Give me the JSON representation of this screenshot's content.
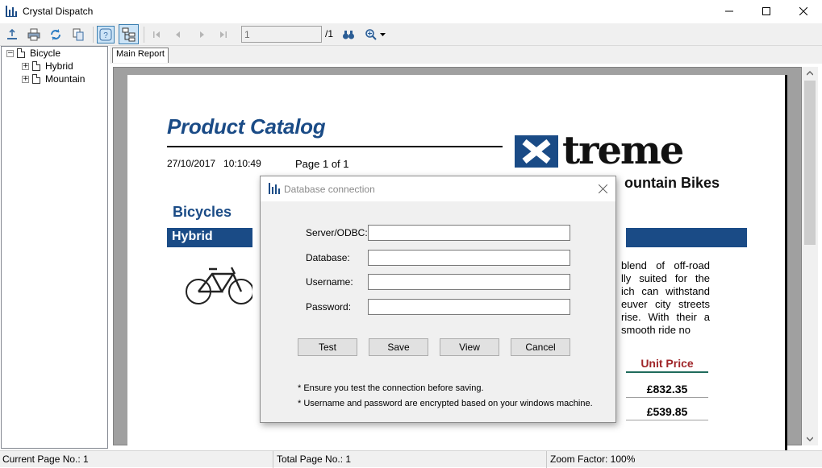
{
  "window": {
    "title": "Crystal Dispatch"
  },
  "toolbar": {
    "page_value": "1",
    "page_total": "/1"
  },
  "tree": {
    "root": "Bicycle",
    "children": [
      "Hybrid",
      "Mountain"
    ]
  },
  "tabs": {
    "main": "Main Report"
  },
  "report": {
    "title": "Product Catalog",
    "date": "27/10/2017   10:10:49",
    "page": "Page 1 of 1",
    "logo_text": "treme",
    "logo_sub": "ountain Bikes",
    "section": "Bicycles",
    "group": "Hybrid",
    "description": "blend of off-road lly suited for the ich can withstand euver city streets rise.  With their a smooth ride no",
    "unit_price_header": "Unit Price",
    "prices": [
      "£832.35",
      "£539.85"
    ]
  },
  "dialog": {
    "title": "Database connection",
    "fields": {
      "server_label": "Server/ODBC:",
      "database_label": "Database:",
      "username_label": "Username:",
      "password_label": "Password:"
    },
    "buttons": {
      "test": "Test",
      "save": "Save",
      "view": "View",
      "cancel": "Cancel"
    },
    "notes": [
      "* Ensure you test the connection before saving.",
      "* Username and password are encrypted based on your windows machine."
    ]
  },
  "status": {
    "current_page": "Current Page No.: 1",
    "total_page": "Total Page No.: 1",
    "zoom": "Zoom Factor: 100%"
  },
  "colors": {
    "brand_blue": "#1a4b86",
    "price_red": "#a0262a"
  }
}
